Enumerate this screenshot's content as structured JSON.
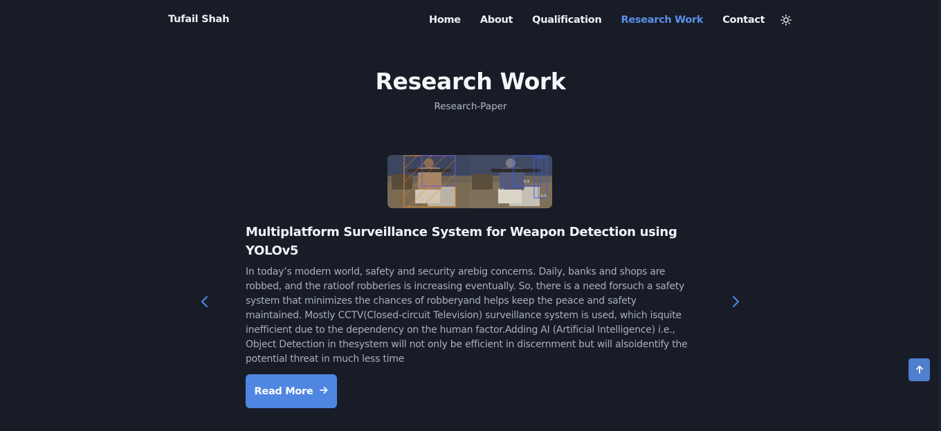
{
  "header": {
    "logo": "Tufail Shah",
    "nav": [
      {
        "label": "Home",
        "active": false
      },
      {
        "label": "About",
        "active": false
      },
      {
        "label": "Qualification",
        "active": false
      },
      {
        "label": "Research Work",
        "active": true
      },
      {
        "label": "Contact",
        "active": false
      }
    ],
    "theme_icon": "sun-icon"
  },
  "section": {
    "title": "Research Work",
    "subtitle": "Research-Paper"
  },
  "slide": {
    "image_icon": "weapon-detection-image",
    "title": "Multiplatform Surveillance System for Weapon Detection using YOLOv5",
    "description": "In today’s modern world, safety and security arebig concerns. Daily, banks and shops are robbed, and the ratioof robberies is increasing eventually. So, there is a need forsuch a safety system that minimizes the chances of robberyand helps keep the peace and safety maintained. Mostly CCTV(Closed-circuit Television) surveillance system is used, which isquite inefficient due to the dependency on the human factor.Adding AI (Artificial Intelligence) i.e., Object Detection in thesystem will not only be efficient in discernment but will alsoidentify the potential threat in much less time",
    "button_label": "Read More",
    "image_labels": [
      "0.7",
      "0.9",
      "0.5"
    ]
  },
  "controls": {
    "prev_icon": "chevron-left-icon",
    "next_icon": "chevron-right-icon",
    "scroll_top_icon": "arrow-up-icon"
  },
  "colors": {
    "background": "#171c27",
    "accent": "#4f86e2",
    "active_nav": "#5b90e8",
    "text": "#eef0f4",
    "muted_text": "#a9afbb"
  }
}
